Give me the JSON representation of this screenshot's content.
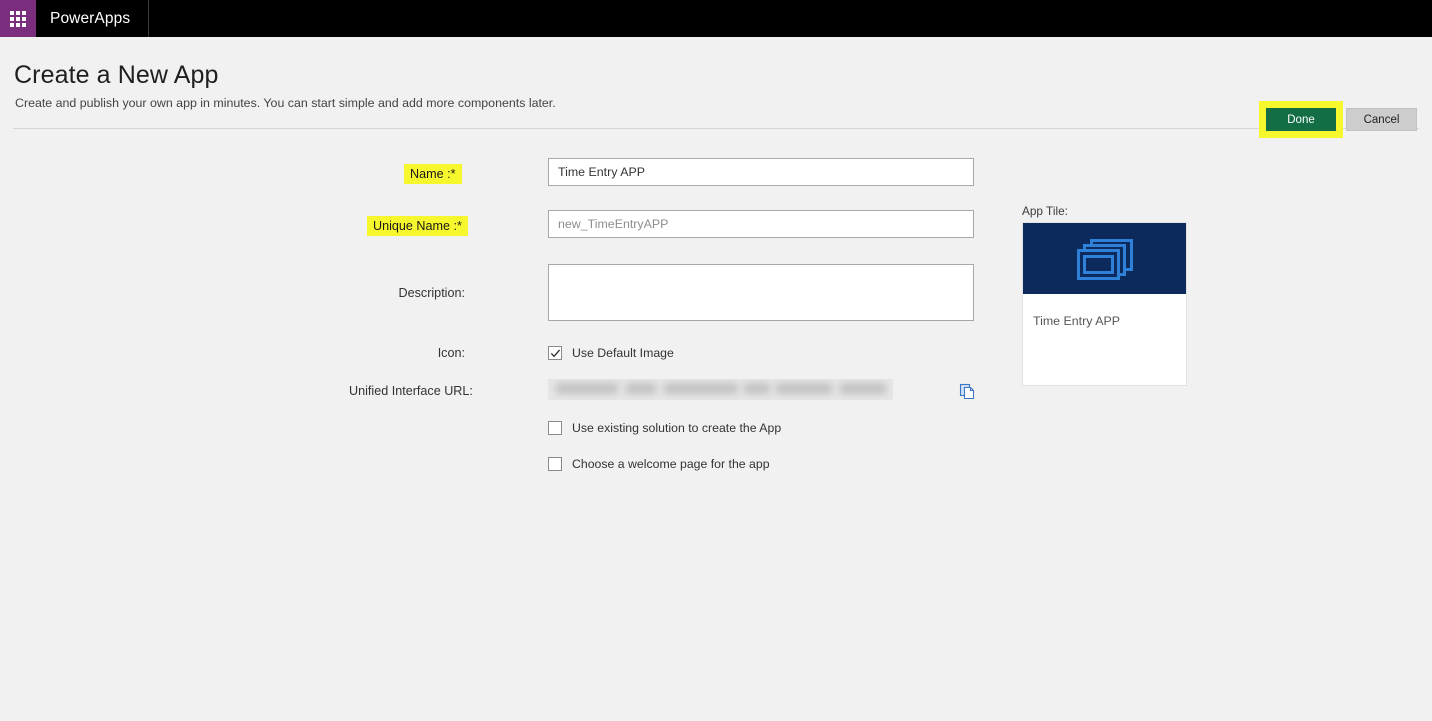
{
  "suite_bar": {
    "waffle_icon": "app-launcher-waffle-icon",
    "brand": "PowerApps"
  },
  "header": {
    "title": "Create a New App",
    "subtitle": "Create and publish your own app in minutes. You can start simple and add more components later.",
    "done_label": "Done",
    "cancel_label": "Cancel",
    "done_highlight_color": "#f7f72e",
    "done_button_color": "#136e46",
    "cancel_button_color": "#cdcdcd"
  },
  "form": {
    "name": {
      "label": "Name :*",
      "value": "Time Entry APP",
      "highlighted": true
    },
    "unique_name": {
      "label": "Unique Name :*",
      "value": "new_TimeEntryAPP",
      "highlighted": true
    },
    "description": {
      "label": "Description:",
      "value": "",
      "placeholder": ""
    },
    "icon": {
      "label": "Icon:",
      "checkbox_label": "Use Default Image",
      "checked": true
    },
    "unified_interface_url": {
      "label": "Unified Interface URL:",
      "value": "",
      "redacted": true,
      "copy_icon": "copy-icon"
    },
    "use_existing_solution": {
      "label": "Use existing solution to create the App",
      "checked": false
    },
    "choose_welcome_page": {
      "label": "Choose a welcome page for the app",
      "checked": false
    }
  },
  "app_tile": {
    "label": "App Tile:",
    "name": "Time Entry APP",
    "header_color": "#0c2a5c",
    "icon_color": "#2f80d8",
    "icon_name": "stacked-windows-icon"
  }
}
